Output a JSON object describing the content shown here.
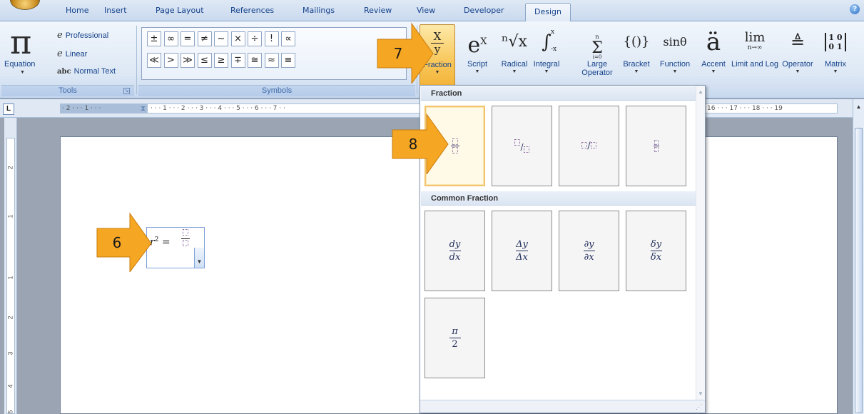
{
  "tabs": [
    "Home",
    "Insert",
    "Page Layout",
    "References",
    "Mailings",
    "Review",
    "View",
    "Developer",
    "Design"
  ],
  "tabs_active": "Design",
  "tools": {
    "equation_label": "Equation",
    "professional_label": "Professional",
    "linear_label": "Linear",
    "normal_text_label": "Normal Text",
    "abc_mark": "abc",
    "group_label": "Tools"
  },
  "symbols": {
    "group_label": "Symbols",
    "row1": [
      "±",
      "∞",
      "=",
      "≠",
      "~",
      "×",
      "÷",
      "!",
      "∝"
    ],
    "row2": [
      "≪",
      ">",
      "≫",
      "≤",
      "≥",
      "∓",
      "≅",
      "≈",
      "≡"
    ]
  },
  "structures": [
    {
      "key": "fraction",
      "label": "Fraction"
    },
    {
      "key": "script",
      "label": "Script"
    },
    {
      "key": "radical",
      "label": "Radical"
    },
    {
      "key": "integral",
      "label": "Integral"
    },
    {
      "key": "large_operator",
      "label": "Large Operator"
    },
    {
      "key": "bracket",
      "label": "Bracket"
    },
    {
      "key": "function",
      "label": "Function"
    },
    {
      "key": "accent",
      "label": "Accent"
    },
    {
      "key": "limit_log",
      "label": "Limit and Log"
    },
    {
      "key": "operator",
      "label": "Operator"
    },
    {
      "key": "matrix",
      "label": "Matrix"
    }
  ],
  "glyphs": {
    "fraction_num": "X",
    "fraction_den": "y",
    "script": "e",
    "script_sup": "X",
    "radical": "ⁿ√x",
    "integral": "∫",
    "integral_upper": "x",
    "integral_lower": "-x",
    "large_op": "Σ",
    "large_op_upper": "n",
    "large_op_lower": "i=0",
    "bracket": "{()}",
    "function": "sinθ",
    "accent": "ä",
    "limit": "lim",
    "limit_sub": "n→∞",
    "matrix_row1": "1 0",
    "matrix_row2": "0 1"
  },
  "ruler_left": "· 2 · · · 1 · · ·",
  "ruler_main": "· · · 1 · · · 2 · · · 3 · · · 4 · · · 5 · · · 6 · · · 7 · ·",
  "ruler_right": "16 · · · 17 · · · 18 · · · 19",
  "vruler_numbers": [
    "2",
    "1",
    "1",
    "2",
    "3",
    "4",
    "5"
  ],
  "equation": {
    "lhs": "r",
    "exponent": "2",
    "equals": "="
  },
  "gallery": {
    "section1": "Fraction",
    "section2": "Common Fraction",
    "common": [
      {
        "num": "dy",
        "den": "dx"
      },
      {
        "num": "Δy",
        "den": "Δx"
      },
      {
        "num": "∂y",
        "den": "∂x"
      },
      {
        "num": "δy",
        "den": "δx"
      },
      {
        "num": "π",
        "den": "2"
      }
    ],
    "linear_sep": "/"
  },
  "callouts": [
    "6",
    "7",
    "8"
  ],
  "colors": {
    "ribbon_text": "#15428b",
    "selected_button": "#f8c85c",
    "callout_orange": "#f5a623"
  }
}
